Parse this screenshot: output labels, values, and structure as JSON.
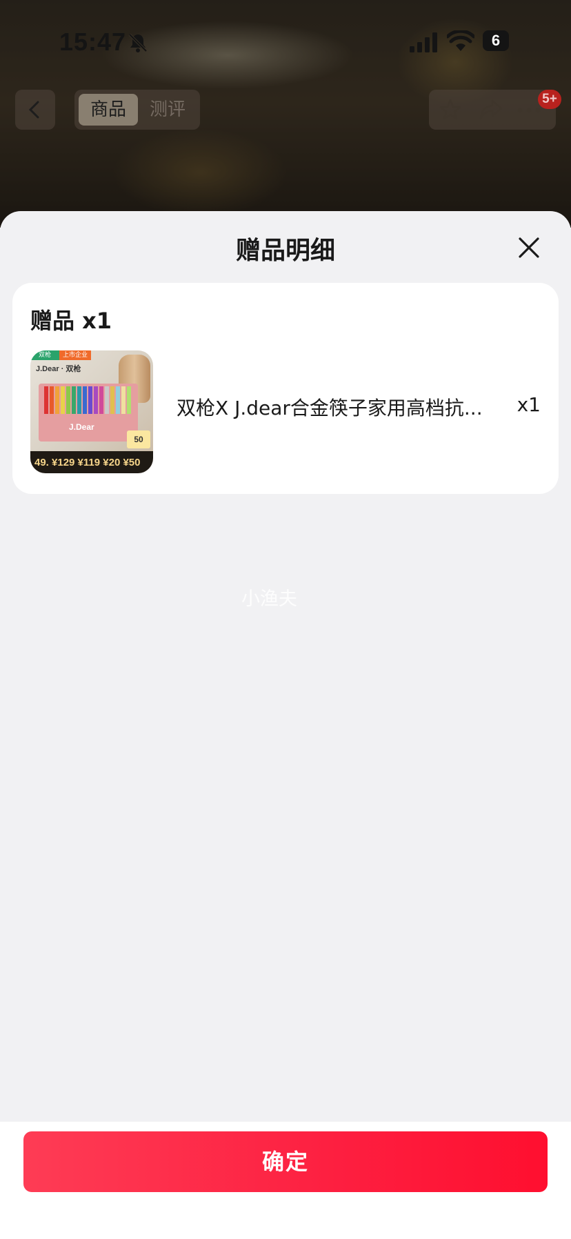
{
  "status_bar": {
    "time": "15:47",
    "battery_level": "6",
    "icons": [
      "bell-off-icon",
      "signal-icon",
      "wifi-icon",
      "battery-icon"
    ]
  },
  "nav": {
    "tabs": [
      {
        "label": "商品",
        "active": true
      },
      {
        "label": "测评",
        "active": false
      }
    ],
    "badge": "5+",
    "icons": [
      "back-icon",
      "star-icon",
      "share-icon",
      "more-icon"
    ]
  },
  "sheet": {
    "title": "赠品明细",
    "heading": "赠品 x1",
    "items": [
      {
        "name": "双枪X J.dear合金筷子家用高档抗...",
        "quantity": "x1",
        "thumbnail": {
          "tag_left": "双枪",
          "tag_right": "上市企业",
          "brand": "J.Dear · 双枪",
          "box_logo": "J.Dear",
          "badge": "50",
          "prices": "49. ¥129 ¥119 ¥20 ¥50"
        }
      }
    ]
  },
  "watermark": "小渔夫",
  "footer": {
    "confirm_label": "确定"
  },
  "colors": {
    "accent": "#fe2c48",
    "sheet_bg": "#f1f1f3",
    "card_bg": "#ffffff",
    "badge_red": "#b8221e"
  }
}
